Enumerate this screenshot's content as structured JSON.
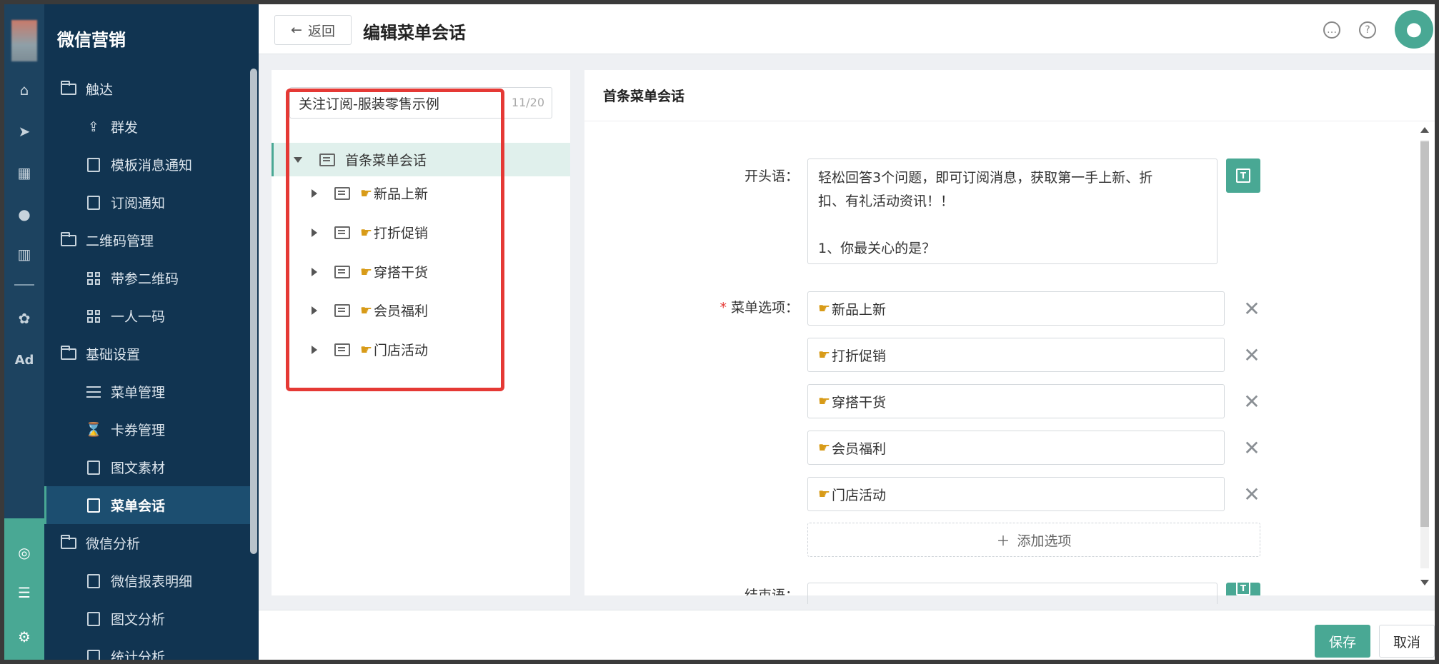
{
  "sidebar": {
    "title": "微信营销",
    "items": [
      {
        "label": "触达",
        "type": "group",
        "icon": "folder-icon"
      },
      {
        "label": "群发",
        "type": "sub",
        "icon": "share-icon"
      },
      {
        "label": "模板消息通知",
        "type": "sub",
        "icon": "message-icon"
      },
      {
        "label": "订阅通知",
        "type": "sub",
        "icon": "message-icon"
      },
      {
        "label": "二维码管理",
        "type": "group",
        "icon": "folder-icon"
      },
      {
        "label": "带参二维码",
        "type": "sub",
        "icon": "qrcode-icon"
      },
      {
        "label": "一人一码",
        "type": "sub",
        "icon": "qrcode-icon"
      },
      {
        "label": "基础设置",
        "type": "group",
        "icon": "folder-icon"
      },
      {
        "label": "菜单管理",
        "type": "sub",
        "icon": "list-icon"
      },
      {
        "label": "卡券管理",
        "type": "sub",
        "icon": "coupon-icon"
      },
      {
        "label": "图文素材",
        "type": "sub",
        "icon": "document-icon"
      },
      {
        "label": "菜单会话",
        "type": "sub",
        "icon": "chat-icon",
        "active": true
      },
      {
        "label": "微信分析",
        "type": "group",
        "icon": "folder-icon"
      },
      {
        "label": "微信报表明细",
        "type": "sub",
        "icon": "document-icon"
      },
      {
        "label": "图文分析",
        "type": "sub",
        "icon": "document-icon"
      },
      {
        "label": "统计分析",
        "type": "sub",
        "icon": "chart-icon"
      }
    ],
    "rail_ad_label": "Ad"
  },
  "header": {
    "back_label": "返回",
    "title": "编辑菜单会话"
  },
  "tree": {
    "name_value": "关注订阅-服装零售示例",
    "name_count": "11/20",
    "root_label": "首条菜单会话",
    "children": [
      "新品上新",
      "打折促销",
      "穿搭干货",
      "会员福利",
      "门店活动"
    ]
  },
  "editor": {
    "heading": "首条菜单会话",
    "opener_label": "开头语：",
    "opener_lines": [
      "轻松回答3个问题，即可订阅消息，获取第一手上新、折",
      "扣、有礼活动资讯！！",
      "",
      "1、你最关心的是？"
    ],
    "options_label": "菜单选项：",
    "options": [
      "新品上新",
      "打折促销",
      "穿搭干货",
      "会员福利",
      "门店活动"
    ],
    "add_option_label": "添加选项",
    "closing_label": "结束语："
  },
  "footer": {
    "save_label": "保存",
    "cancel_label": "取消"
  },
  "colors": {
    "accent": "#49a894",
    "sidebar_bg": "#113451",
    "rail_bg": "#1d4360",
    "highlight_box": "#e53935"
  }
}
